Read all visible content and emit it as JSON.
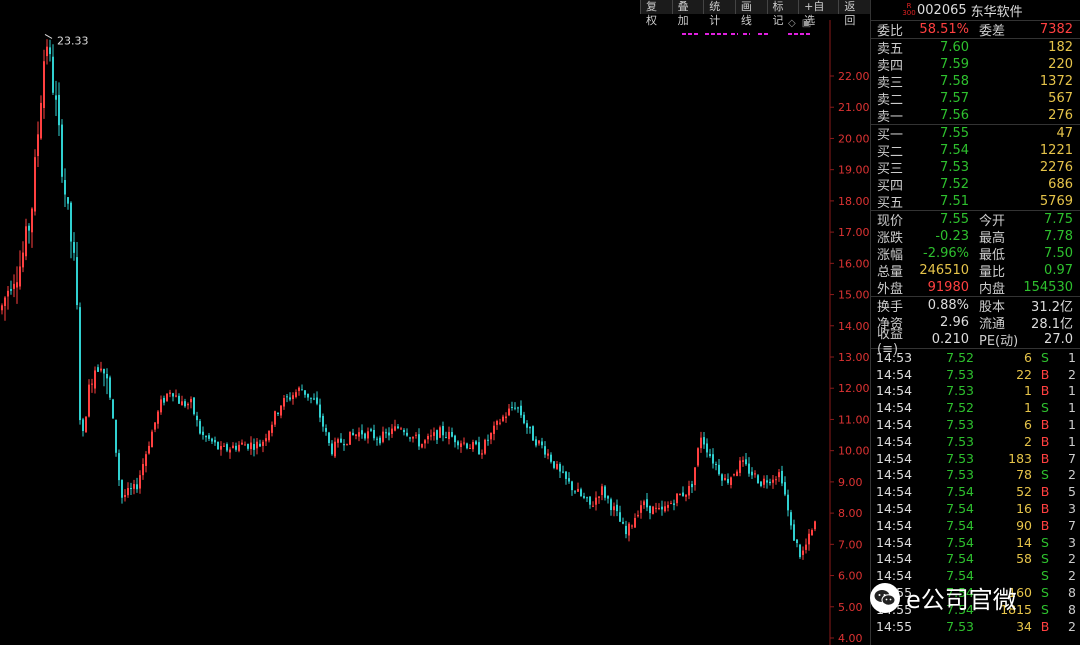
{
  "toolbar": [
    "复权",
    "叠加",
    "统计",
    "画线",
    "标记",
    "+自选",
    "返回"
  ],
  "header": {
    "badge_top": "R",
    "badge_bottom": "300",
    "code": "002065",
    "name": "东华软件"
  },
  "commission": {
    "ratio_label": "委比",
    "ratio": "58.51%",
    "diff_label": "委差",
    "diff": "7382"
  },
  "asks": [
    {
      "label": "卖五",
      "price": "7.60",
      "vol": "182"
    },
    {
      "label": "卖四",
      "price": "7.59",
      "vol": "220"
    },
    {
      "label": "卖三",
      "price": "7.58",
      "vol": "1372"
    },
    {
      "label": "卖二",
      "price": "7.57",
      "vol": "567"
    },
    {
      "label": "卖一",
      "price": "7.56",
      "vol": "276"
    }
  ],
  "bids": [
    {
      "label": "买一",
      "price": "7.55",
      "vol": "47"
    },
    {
      "label": "买二",
      "price": "7.54",
      "vol": "1221"
    },
    {
      "label": "买三",
      "price": "7.53",
      "vol": "2276"
    },
    {
      "label": "买四",
      "price": "7.52",
      "vol": "686"
    },
    {
      "label": "买五",
      "price": "7.51",
      "vol": "5769"
    }
  ],
  "stats1": [
    {
      "l1": "现价",
      "v1": "7.55",
      "c1": "green",
      "l2": "今开",
      "v2": "7.75",
      "c2": "green"
    },
    {
      "l1": "涨跌",
      "v1": "-0.23",
      "c1": "green",
      "l2": "最高",
      "v2": "7.78",
      "c2": "green"
    },
    {
      "l1": "涨幅",
      "v1": "-2.96%",
      "c1": "green",
      "l2": "最低",
      "v2": "7.50",
      "c2": "green"
    },
    {
      "l1": "总量",
      "v1": "246510",
      "c1": "yellow",
      "l2": "量比",
      "v2": "0.97",
      "c2": "green"
    },
    {
      "l1": "外盘",
      "v1": "91980",
      "c1": "red",
      "l2": "内盘",
      "v2": "154530",
      "c2": "green"
    }
  ],
  "stats2": [
    {
      "l1": "换手",
      "v1": "0.88%",
      "c1": "white",
      "l2": "股本",
      "v2": "31.2亿",
      "c2": "white"
    },
    {
      "l1": "净资",
      "v1": "2.96",
      "c1": "white",
      "l2": "流通",
      "v2": "28.1亿",
      "c2": "white"
    },
    {
      "l1": "收益(≡)",
      "v1": "0.210",
      "c1": "white",
      "l2": "PE(动)",
      "v2": "27.0",
      "c2": "white"
    }
  ],
  "ticks": [
    {
      "time": "14:53",
      "price": "7.52",
      "vol": "6",
      "bs": "S",
      "n": "1"
    },
    {
      "time": "14:54",
      "price": "7.53",
      "vol": "22",
      "bs": "B",
      "n": "2"
    },
    {
      "time": "14:54",
      "price": "7.53",
      "vol": "1",
      "bs": "B",
      "n": "1"
    },
    {
      "time": "14:54",
      "price": "7.52",
      "vol": "1",
      "bs": "S",
      "n": "1"
    },
    {
      "time": "14:54",
      "price": "7.53",
      "vol": "6",
      "bs": "B",
      "n": "1"
    },
    {
      "time": "14:54",
      "price": "7.53",
      "vol": "2",
      "bs": "B",
      "n": "1"
    },
    {
      "time": "14:54",
      "price": "7.53",
      "vol": "183",
      "bs": "B",
      "n": "7"
    },
    {
      "time": "14:54",
      "price": "7.53",
      "vol": "78",
      "bs": "S",
      "n": "2"
    },
    {
      "time": "14:54",
      "price": "7.54",
      "vol": "52",
      "bs": "B",
      "n": "5"
    },
    {
      "time": "14:54",
      "price": "7.54",
      "vol": "16",
      "bs": "B",
      "n": "3"
    },
    {
      "time": "14:54",
      "price": "7.54",
      "vol": "90",
      "bs": "B",
      "n": "7"
    },
    {
      "time": "14:54",
      "price": "7.54",
      "vol": "14",
      "bs": "S",
      "n": "3"
    },
    {
      "time": "14:54",
      "price": "7.54",
      "vol": "58",
      "bs": "S",
      "n": "2"
    },
    {
      "time": "14:54",
      "price": "7.54",
      "vol": "",
      "bs": "S",
      "n": "2"
    },
    {
      "time": "14:55",
      "price": "7.54",
      "vol": "160",
      "bs": "S",
      "n": "8"
    },
    {
      "time": "14:55",
      "price": "7.54",
      "vol": "1815",
      "bs": "S",
      "n": "8"
    },
    {
      "time": "14:55",
      "price": "7.53",
      "vol": "34",
      "bs": "B",
      "n": "2"
    }
  ],
  "chart_data": {
    "type": "candlestick",
    "y_axis_ticks": [
      "22.00",
      "21.00",
      "20.00",
      "19.00",
      "18.00",
      "17.00",
      "16.00",
      "15.00",
      "14.00",
      "13.00",
      "12.00",
      "11.00",
      "10.00",
      "9.00",
      "8.00",
      "7.00",
      "6.00",
      "5.00",
      "4.00"
    ],
    "ylim": [
      4,
      23.5
    ],
    "peak_label": "23.33",
    "up_color": "#ff4040",
    "down_color": "#30d0d0",
    "trend_x": [
      0,
      10,
      20,
      30,
      45,
      55,
      65,
      75,
      80,
      90,
      100,
      110,
      120,
      135,
      150,
      160,
      170,
      180,
      190,
      200,
      210,
      220,
      240,
      260,
      280,
      300,
      315,
      330,
      340,
      360,
      380,
      400,
      420,
      440,
      460,
      480,
      500,
      515,
      530,
      545,
      560,
      575,
      590,
      600,
      615,
      625,
      640,
      660,
      675,
      690,
      700,
      710,
      725,
      740,
      760,
      780,
      790,
      800,
      815
    ],
    "trend_y": [
      14.5,
      15.5,
      16.0,
      17.5,
      23.33,
      21.0,
      18.0,
      15.5,
      10.0,
      12.5,
      13.0,
      11.5,
      8.5,
      8.8,
      10.5,
      11.5,
      12.0,
      11.5,
      11.5,
      10.5,
      10.3,
      10.0,
      10.2,
      10.2,
      11.5,
      12.0,
      11.5,
      10.0,
      10.3,
      10.6,
      10.4,
      10.8,
      10.2,
      10.6,
      10.3,
      10.0,
      11.0,
      11.5,
      10.5,
      10.0,
      9.2,
      8.7,
      8.2,
      8.8,
      8.0,
      7.3,
      8.3,
      8.0,
      8.5,
      8.8,
      10.5,
      9.8,
      9.0,
      9.6,
      9.0,
      9.3,
      7.5,
      6.6,
      7.7
    ]
  },
  "watermark": {
    "text": "e公司官微"
  }
}
